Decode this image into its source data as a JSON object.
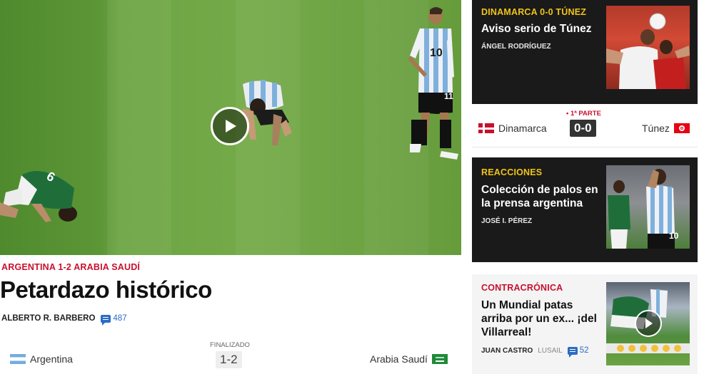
{
  "main": {
    "kicker": "ARGENTINA 1-2 ARABIA SAUDÍ",
    "title": "Petardazo histórico",
    "author": "ALBERTO R. BARBERO",
    "comments": "487",
    "match": {
      "status": "FINALIZADO",
      "home": "Argentina",
      "score": "1-2",
      "away": "Arabia Saudí"
    },
    "hero": {
      "home_shirt_number": "10",
      "home_shirt_number_alt": "11",
      "away_shirt_number": "6"
    }
  },
  "sidebar": {
    "card1": {
      "kicker": "DINAMARCA 0-0 TÚNEZ",
      "headline": "Aviso serio de Túnez",
      "author": "ÁNGEL RODRÍGUEZ"
    },
    "match": {
      "status": "1ª PARTE",
      "home": "Dinamarca",
      "score": "0-0",
      "away": "Túnez"
    },
    "card2": {
      "kicker": "REACCIONES",
      "headline": "Colección de palos en la prensa argentina",
      "author": "JOSÉ I. PÉREZ",
      "shirt_number": "10"
    },
    "card3": {
      "kicker": "CONTRACRÓNICA",
      "headline": "Un Mundial patas arriba por un ex... ¡del Villarreal!",
      "author": "JUAN CASTRO",
      "location": "LUSAIL",
      "comments": "52"
    }
  },
  "colors": {
    "accent_red": "#c8102e",
    "accent_gold": "#f0c419",
    "link_blue": "#2b6cc4"
  },
  "icons": [
    "play-icon",
    "comment-icon",
    "argentina-flag-icon",
    "saudi-flag-icon",
    "denmark-flag-icon",
    "tunisia-flag-icon"
  ]
}
